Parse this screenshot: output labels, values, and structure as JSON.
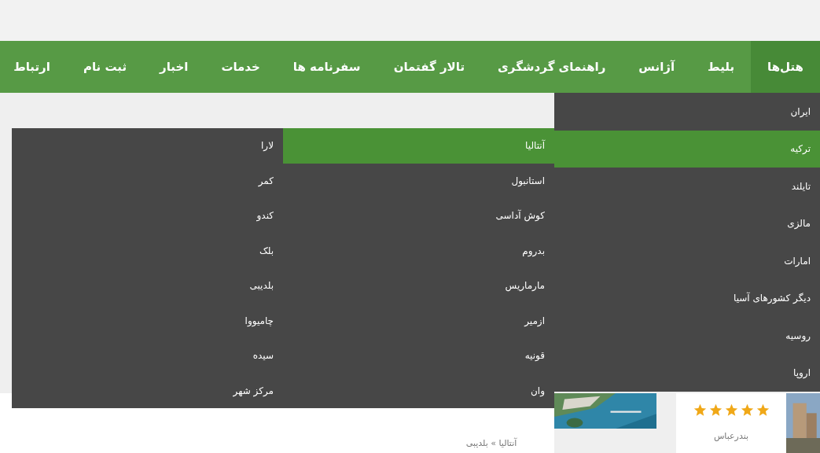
{
  "nav": [
    {
      "label": "هتل‌ها",
      "selected": true
    },
    {
      "label": "بلیط",
      "selected": false
    },
    {
      "label": "آژانس",
      "selected": false
    },
    {
      "label": "راهنمای گردشگری",
      "selected": false
    },
    {
      "label": "تالار گفتمان",
      "selected": false
    },
    {
      "label": "سفرنامه ها",
      "selected": false
    },
    {
      "label": "خدمات",
      "selected": false
    },
    {
      "label": "اخبار",
      "selected": false
    },
    {
      "label": "ثبت نام",
      "selected": false
    },
    {
      "label": "ارتباط",
      "selected": false
    }
  ],
  "menu": {
    "countries": [
      {
        "label": "ایران",
        "selected": false
      },
      {
        "label": "ترکیه",
        "selected": true
      },
      {
        "label": "تایلند",
        "selected": false
      },
      {
        "label": "مالزی",
        "selected": false
      },
      {
        "label": "امارات",
        "selected": false
      },
      {
        "label": "دیگر کشورهای آسیا",
        "selected": false
      },
      {
        "label": "روسیه",
        "selected": false
      },
      {
        "label": "اروپا",
        "selected": false
      }
    ],
    "cities": [
      {
        "label": "آنتالیا",
        "selected": true
      },
      {
        "label": "استانبول",
        "selected": false
      },
      {
        "label": "کوش آداسی",
        "selected": false
      },
      {
        "label": "بدروم",
        "selected": false
      },
      {
        "label": "مارماریس",
        "selected": false
      },
      {
        "label": "ازمیر",
        "selected": false
      },
      {
        "label": "قونیه",
        "selected": false
      },
      {
        "label": "وان",
        "selected": false
      }
    ],
    "districts": [
      {
        "label": "لارا",
        "selected": false
      },
      {
        "label": "کمر",
        "selected": false
      },
      {
        "label": "کندو",
        "selected": false
      },
      {
        "label": "بلک",
        "selected": false
      },
      {
        "label": "بلدیبی",
        "selected": false
      },
      {
        "label": "چامیووا",
        "selected": false
      },
      {
        "label": "سیده",
        "selected": false
      },
      {
        "label": "مرکز شهر",
        "selected": false
      }
    ]
  },
  "cards": [
    {
      "caption": "بندرعباس",
      "stars": 5
    },
    {
      "caption": "آنتالیا » بلدیبی"
    }
  ]
}
